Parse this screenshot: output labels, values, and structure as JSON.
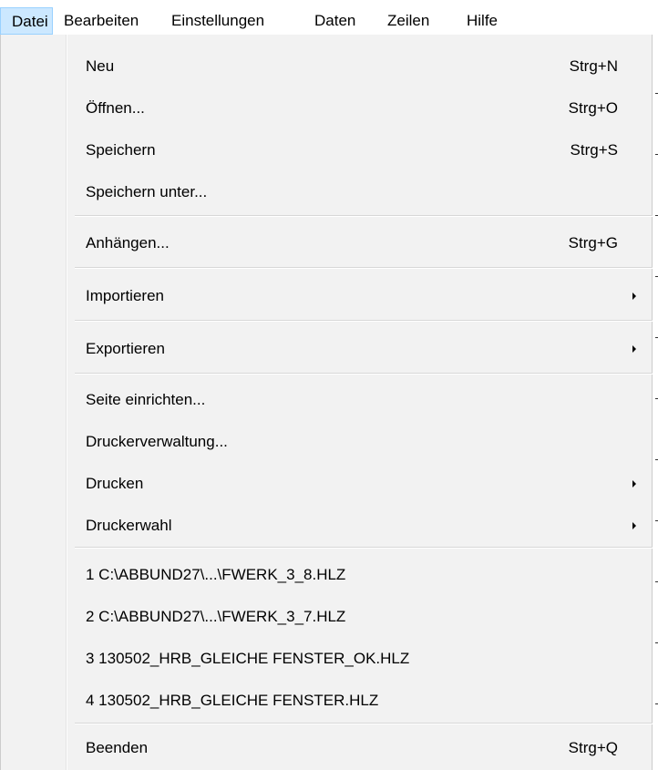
{
  "menubar": {
    "items": [
      "Datei",
      "Bearbeiten",
      "Einstellungen",
      "Daten",
      "Zeilen",
      "Hilfe"
    ]
  },
  "file_menu": {
    "new": {
      "label": "Neu",
      "shortcut": "Strg+N"
    },
    "open": {
      "label": "Öffnen...",
      "shortcut": "Strg+O"
    },
    "save": {
      "label": "Speichern",
      "shortcut": "Strg+S"
    },
    "save_as": {
      "label": "Speichern unter..."
    },
    "append": {
      "label": "Anhängen...",
      "shortcut": "Strg+G"
    },
    "import": {
      "label": "Importieren",
      "submenu_icon": "submenu-arrow"
    },
    "export": {
      "label": "Exportieren",
      "submenu_icon": "submenu-arrow"
    },
    "page_setup": {
      "label": "Seite einrichten..."
    },
    "printer_mgmt": {
      "label": "Druckerverwaltung..."
    },
    "print": {
      "label": "Drucken",
      "submenu_icon": "submenu-arrow"
    },
    "printer_select": {
      "label": "Druckerwahl",
      "submenu_icon": "submenu-arrow"
    },
    "recent": [
      "1 C:\\ABBUND27\\...\\FWERK_3_8.HLZ",
      "2 C:\\ABBUND27\\...\\FWERK_3_7.HLZ",
      "3 130502_HRB_GLEICHE FENSTER_OK.HLZ",
      "4 130502_HRB_GLEICHE FENSTER.HLZ"
    ],
    "exit": {
      "label": "Beenden",
      "shortcut": "Strg+Q"
    }
  },
  "colors": {
    "menu_background": "#f2f2f2",
    "active_menu_highlight": "#cce8ff",
    "active_menu_border": "#99d1ff",
    "separator": "#d7d7d7"
  }
}
